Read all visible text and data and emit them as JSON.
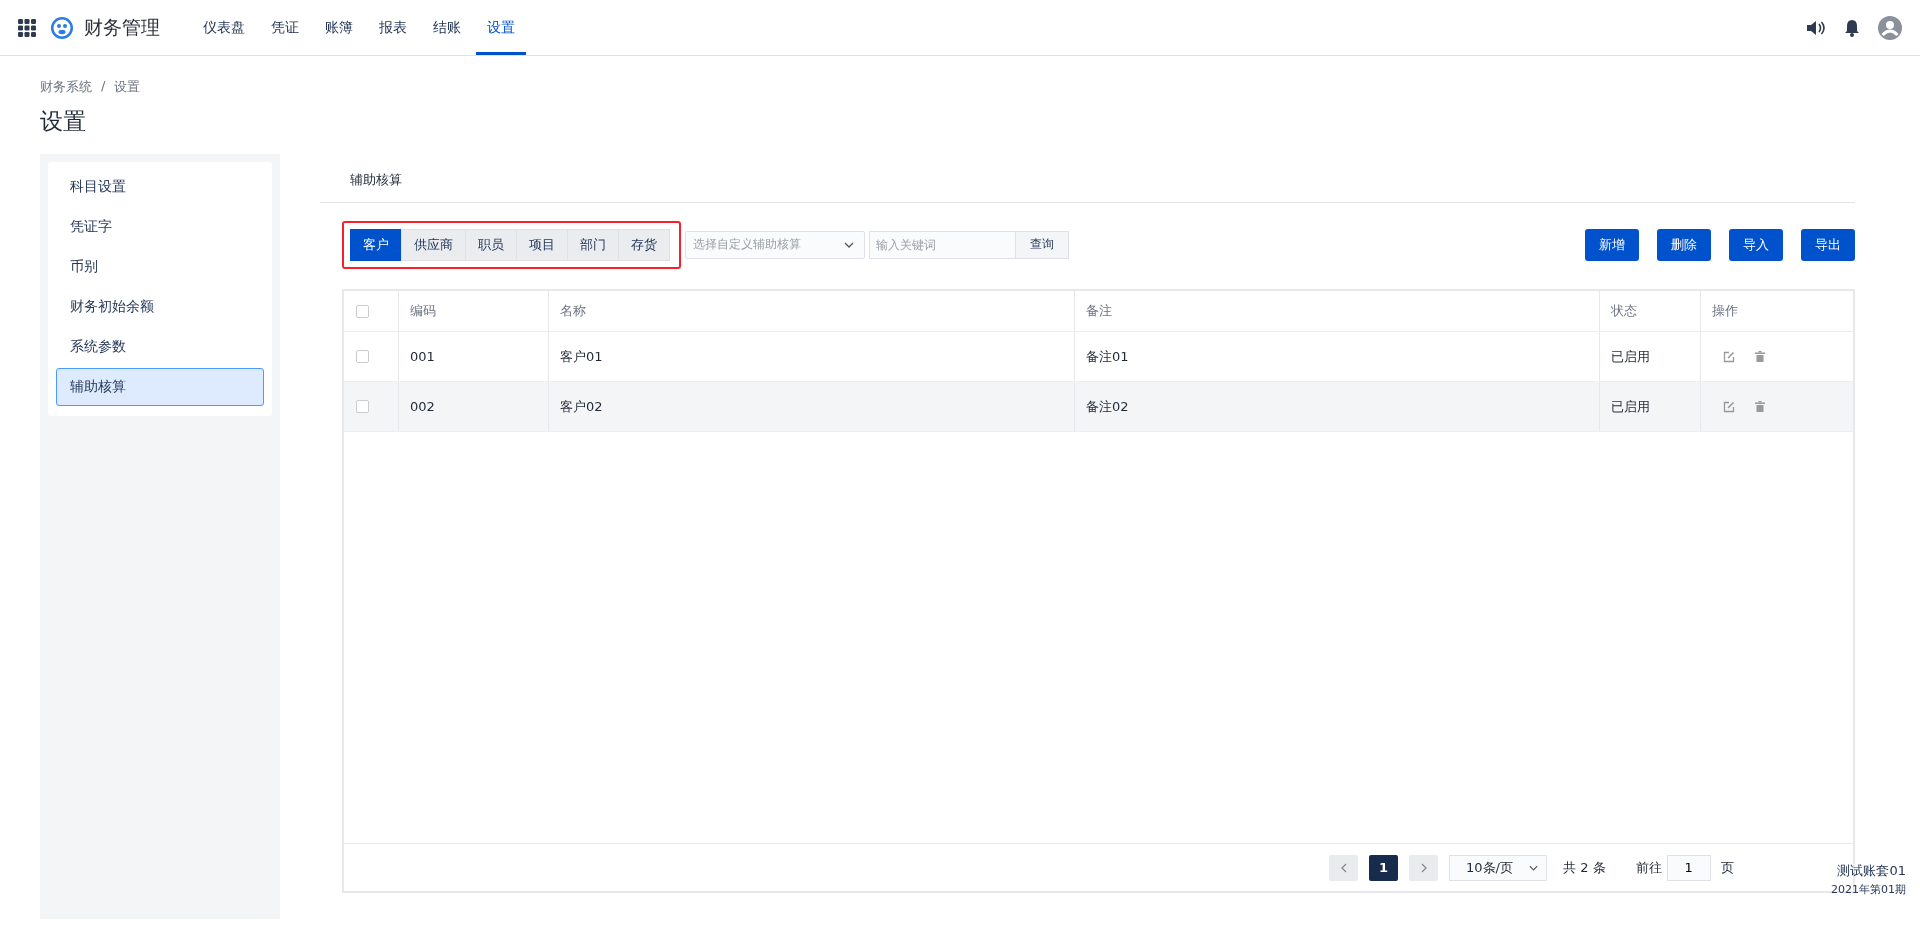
{
  "app": {
    "name": "财务管理"
  },
  "nav": [
    {
      "label": "仪表盘",
      "selected": false
    },
    {
      "label": "凭证",
      "selected": false
    },
    {
      "label": "账簿",
      "selected": false
    },
    {
      "label": "报表",
      "selected": false
    },
    {
      "label": "结账",
      "selected": false
    },
    {
      "label": "设置",
      "selected": true
    }
  ],
  "breadcrumb": [
    "财务系统",
    "/",
    "设置"
  ],
  "page_title": "设置",
  "sidebar": {
    "items": [
      {
        "label": "科目设置",
        "selected": false
      },
      {
        "label": "凭证字",
        "selected": false
      },
      {
        "label": "币别",
        "selected": false
      },
      {
        "label": "财务初始余额",
        "selected": false
      },
      {
        "label": "系统参数",
        "selected": false
      },
      {
        "label": "辅助核算",
        "selected": true
      }
    ]
  },
  "section_tab": "辅助核算",
  "categories": [
    {
      "label": "客户",
      "selected": true
    },
    {
      "label": "供应商",
      "selected": false
    },
    {
      "label": "职员",
      "selected": false
    },
    {
      "label": "项目",
      "selected": false
    },
    {
      "label": "部门",
      "selected": false
    },
    {
      "label": "存货",
      "selected": false
    }
  ],
  "custom_select": {
    "placeholder": "选择自定义辅助核算"
  },
  "search": {
    "placeholder": "输入关键词",
    "button": "查询"
  },
  "actions": [
    "新增",
    "删除",
    "导入",
    "导出"
  ],
  "table": {
    "all_checked": false,
    "columns": [
      "编码",
      "名称",
      "备注",
      "状态",
      "操作"
    ],
    "rows": [
      {
        "code": "001",
        "name": "客户01",
        "note": "备注01",
        "status": "已启用",
        "checked": false
      },
      {
        "code": "002",
        "name": "客户02",
        "note": "备注02",
        "status": "已启用",
        "checked": false
      }
    ]
  },
  "pagination": {
    "current": "1",
    "page_size": "10条/页",
    "total": "共 2 条",
    "goto_label": "前往",
    "goto_value": "1",
    "page_suffix": "页"
  },
  "footer": {
    "account": "测试账套01",
    "period": "2021年第01期"
  }
}
